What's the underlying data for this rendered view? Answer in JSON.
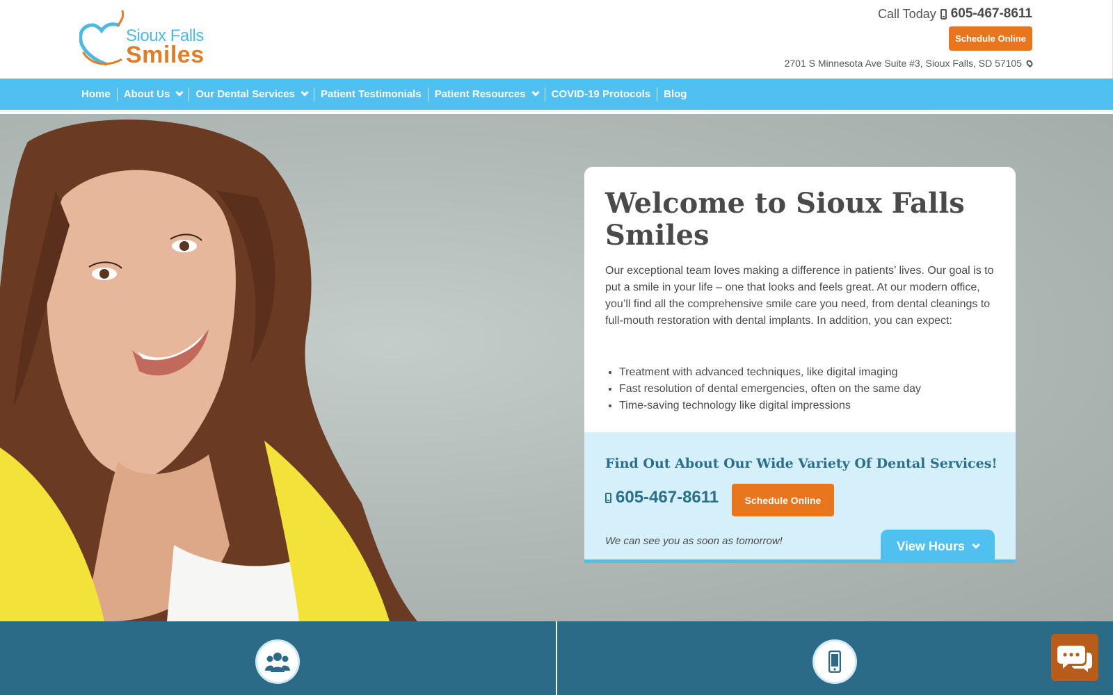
{
  "header": {
    "logo": {
      "line1": "Sioux Falls",
      "line2": "Smiles"
    },
    "call_label": "Call Today",
    "phone": "605-467-8611",
    "schedule_label": "Schedule Online",
    "address": "2701 S Minnesota Ave Suite #3, Sioux Falls, SD 57105"
  },
  "nav": {
    "items": [
      {
        "label": "Home"
      },
      {
        "label": "About Us"
      },
      {
        "label": "Our Dental Services"
      },
      {
        "label": "Patient Testimonials"
      },
      {
        "label": "Patient Resources"
      },
      {
        "label": "COVID-19 Protocols"
      },
      {
        "label": "Blog"
      }
    ]
  },
  "hero": {
    "title": "Welcome to Sioux Falls Smiles",
    "intro": "Our exceptional team loves making a difference in patients’ lives. Our goal is to put a smile in your life – one that looks and feels great. At our modern office, you’ll find all the comprehensive smile care you need, from dental cleanings to full-mouth restoration with dental implants. In addition, you can expect:",
    "bullets": [
      "Treatment with advanced techniques, like digital imaging",
      "Fast resolution of dental emergencies, often on the same day",
      "Time-saving technology like digital impressions"
    ],
    "cta_heading": "Find Out About Our Wide Variety Of Dental Services!",
    "cta_phone": "605-467-8611",
    "cta_schedule": "Schedule Online",
    "cta_note": "We can see you as soon as tomorrow!",
    "view_hours": "View Hours"
  },
  "colors": {
    "nav_blue": "#4fc0f0",
    "orange": "#e8761f",
    "band_teal": "#2b6b87",
    "cta_bg": "#d5f0fb"
  },
  "icons": {
    "band_left": "users-icon",
    "band_right": "mobile-phone-icon",
    "chat": "chat-bubbles-icon"
  }
}
